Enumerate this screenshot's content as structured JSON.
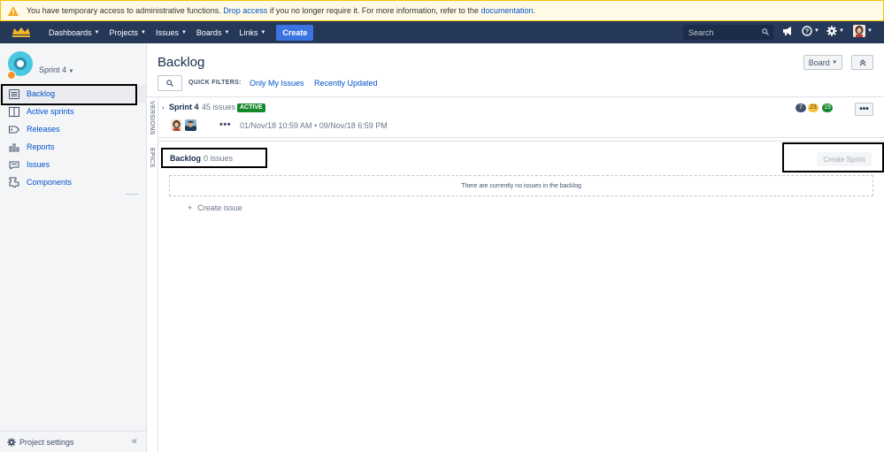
{
  "banner": {
    "text_before": "You have temporary access to administrative functions. ",
    "drop_link": "Drop access",
    "text_middle": " if you no longer require it. For more information, refer to the ",
    "doc_link": "documentation",
    "text_after": "."
  },
  "header": {
    "nav": [
      "Dashboards",
      "Projects",
      "Issues",
      "Boards",
      "Links"
    ],
    "create_label": "Create",
    "search_placeholder": "Search"
  },
  "sidebar": {
    "sprint_selector": "Sprint 4",
    "items": [
      {
        "label": "Backlog",
        "icon": "backlog-icon",
        "active": true
      },
      {
        "label": "Active sprints",
        "icon": "active-sprints-icon"
      },
      {
        "label": "Releases",
        "icon": "releases-icon"
      },
      {
        "label": "Reports",
        "icon": "reports-icon"
      },
      {
        "label": "Issues",
        "icon": "issues-icon"
      },
      {
        "label": "Components",
        "icon": "components-icon"
      }
    ],
    "footer_label": "Project settings",
    "collapse_glyph": "«"
  },
  "main": {
    "title": "Backlog",
    "board_button": "Board",
    "quick_filters_label": "QUICK FILTERS:",
    "quick_filters": [
      "Only My Issues",
      "Recently Updated"
    ],
    "side_tabs": [
      "VERSIONS",
      "EPICS"
    ],
    "sprint": {
      "name": "Sprint 4",
      "count": "45 issues",
      "status": "ACTIVE",
      "pills": [
        {
          "value": "7",
          "color": "#42526e"
        },
        {
          "value": "23",
          "color": "#f6c342"
        },
        {
          "value": "15",
          "color": "#14892c"
        }
      ],
      "dates": "01/Nov/18 10:59 AM • 09/Nov/18 6:59 PM"
    },
    "backlog": {
      "name": "Backlog",
      "count": "0 issues",
      "create_sprint": "Create Sprint",
      "empty_text": "There are currently no issues in the backlog",
      "create_issue": "Create issue"
    }
  },
  "colors": {
    "header_bg": "#253858",
    "create_button": "#3b73e0",
    "link": "#0052cc",
    "banner_bg": "#fffae6",
    "active_lozenge": "#14892c"
  }
}
